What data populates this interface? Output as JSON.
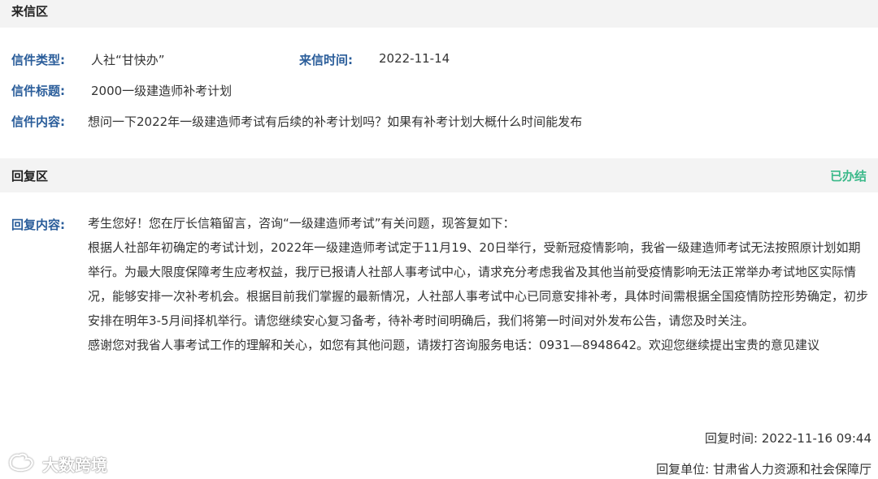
{
  "letter_section": {
    "title": "来信区",
    "type_label": "信件类型:",
    "type_value": "人社“甘快办”",
    "time_label": "来信时间:",
    "time_value": "2022-11-14",
    "subject_label": "信件标题:",
    "subject_value": "2000一级建造师补考计划",
    "content_label": "信件内容:",
    "content_value": "想问一下2022年一级建造师考试有后续的补考计划吗？如果有补考计划大概什么时间能发布"
  },
  "reply_section": {
    "title": "回复区",
    "status": "已办结",
    "content_label": "回复内容:",
    "paragraphs": [
      "考生您好！您在厅长信箱留言，咨询“一级建造师考试”有关问题，现答复如下：",
      "根据人社部年初确定的考试计划，2022年一级建造师考试定于11月19、20日举行，受新冠疫情影响，我省一级建造师考试无法按照原计划如期举行。为最大限度保障考生应考权益，我厅已报请人社部人事考试中心，请求充分考虑我省及其他当前受疫情影响无法正常举办考试地区实际情况，能够安排一次补考机会。根据目前我们掌握的最新情况，人社部人事考试中心已同意安排补考，具体时间需根据全国疫情防控形势确定，初步安排在明年3-5月间择机举行。请您继续安心复习备考，待补考时间明确后，我们将第一时间对外发布公告，请您及时关注。",
      "感谢您对我省人事考试工作的理解和关心，如您有其他问题，请拨打咨询服务电话：0931—8948642。欢迎您继续提出宝贵的意见建议"
    ],
    "reply_time": "回复时间:  2022-11-16 09:44",
    "reply_unit": "回复单位:  甘肃省人力资源和社会保障厅"
  },
  "watermark": {
    "icon": "weibo-icon",
    "text": "大数跨境"
  },
  "colors": {
    "label_blue": "#2a5d9a",
    "status_green": "#3bb98a",
    "header_bg": "#f3f3f3"
  }
}
